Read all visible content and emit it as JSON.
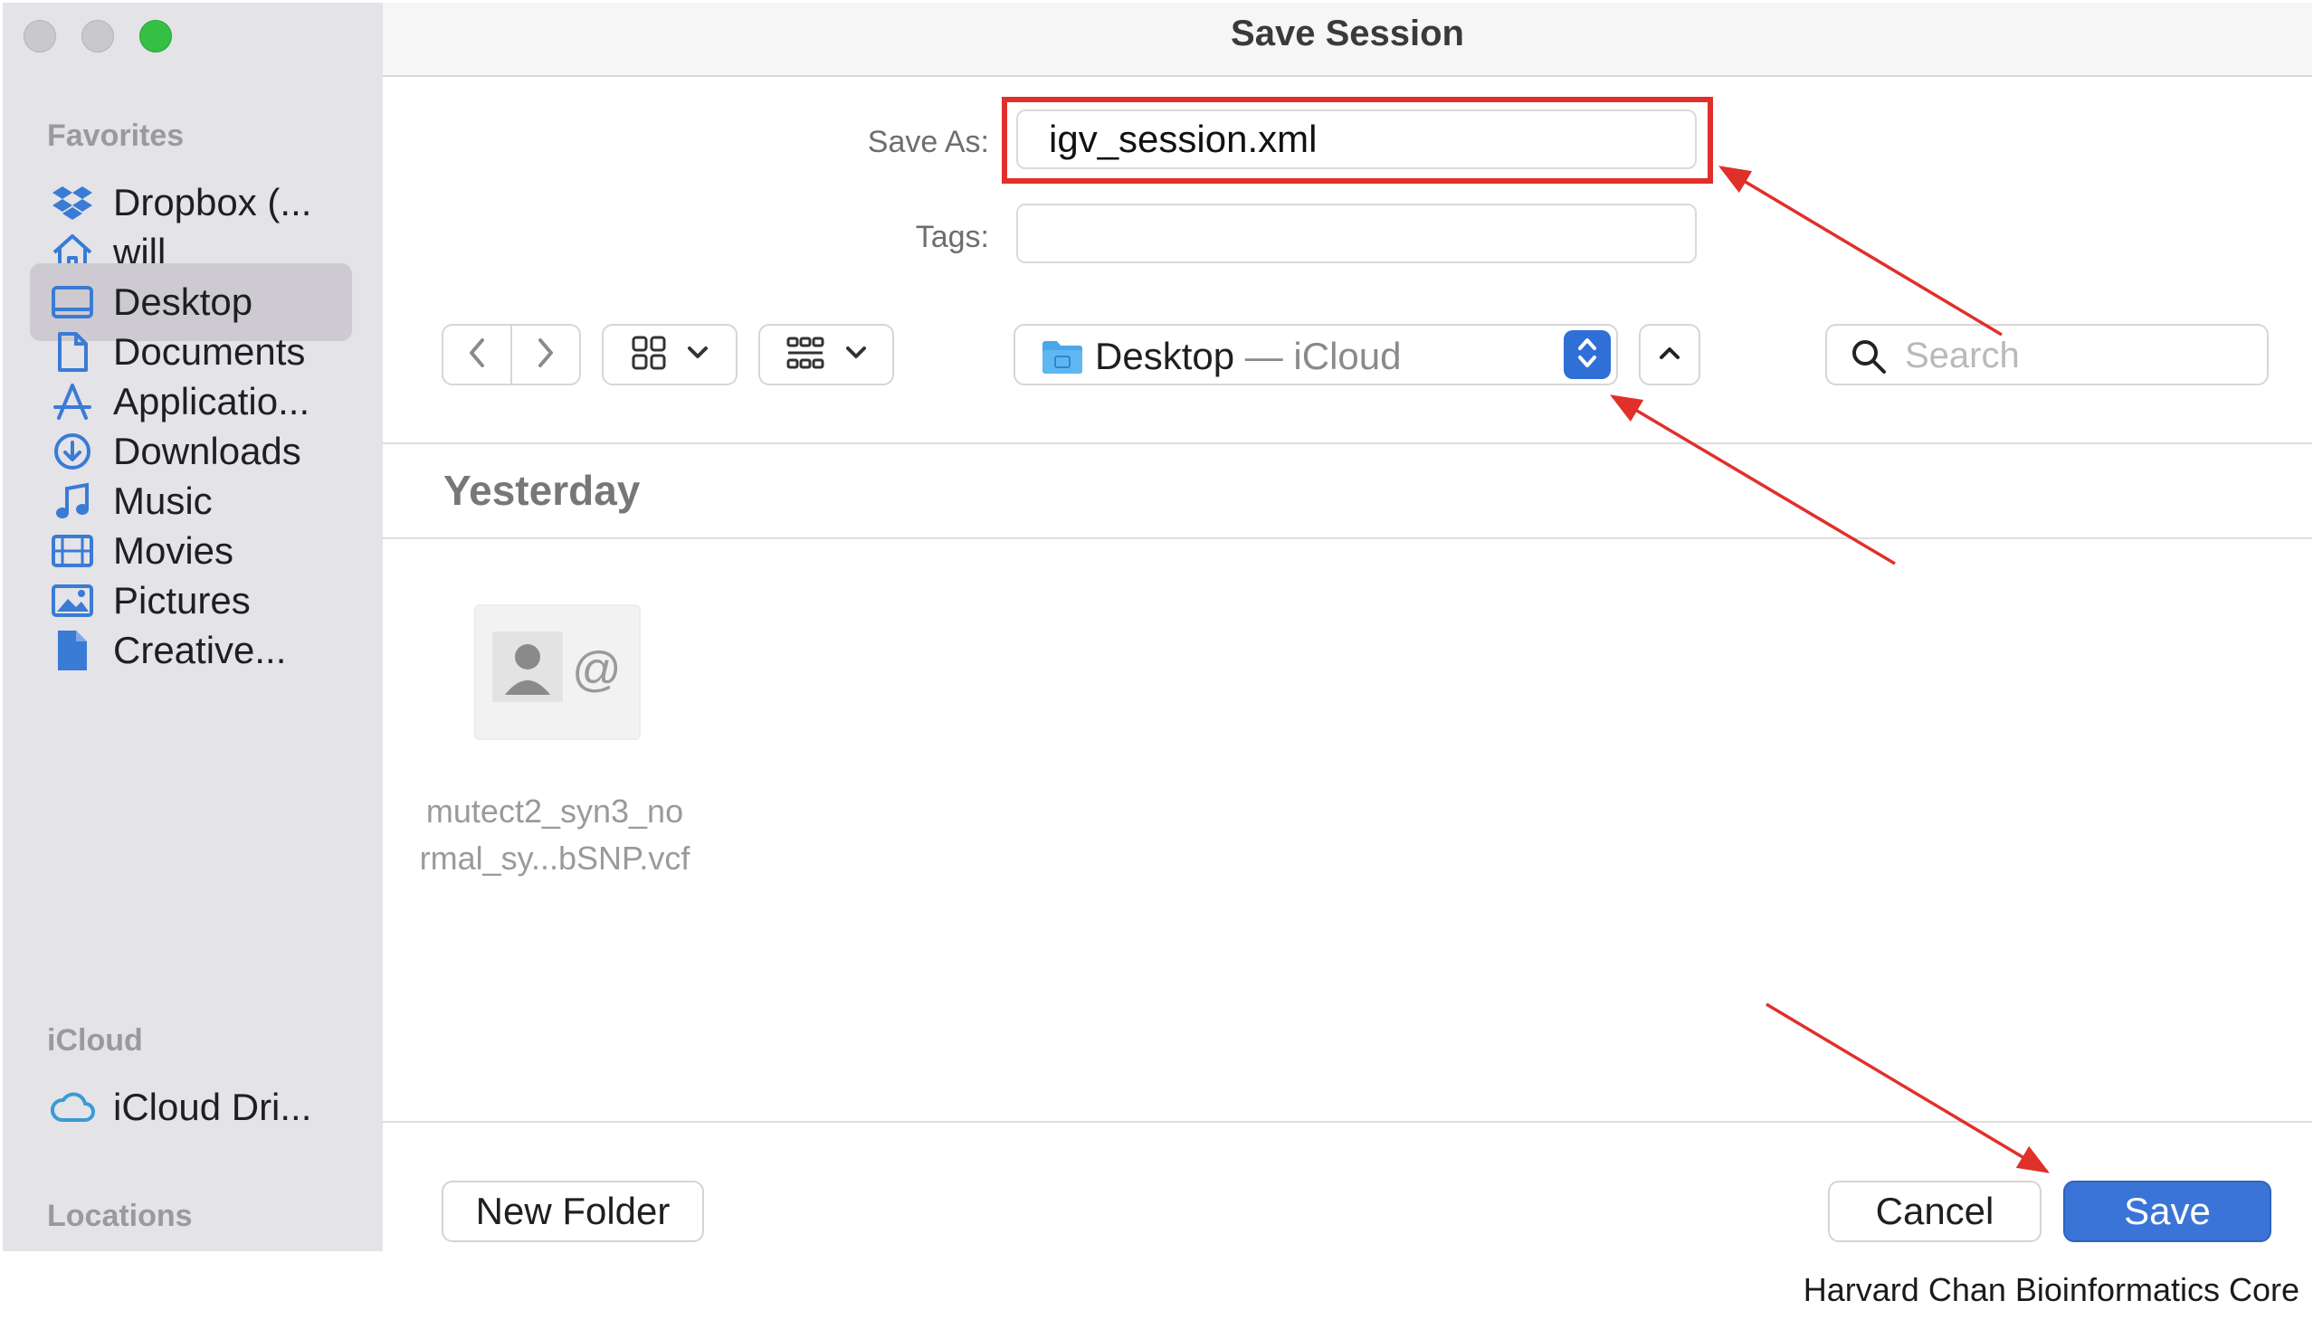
{
  "window": {
    "title": "Save Session"
  },
  "sidebar": {
    "sections": [
      {
        "heading": "Favorites",
        "items": [
          {
            "label": "Dropbox (...",
            "icon": "dropbox-icon",
            "selected": false
          },
          {
            "label": "will",
            "icon": "home-icon",
            "selected": false
          },
          {
            "label": "Desktop",
            "icon": "desktop-icon",
            "selected": true
          },
          {
            "label": "Documents",
            "icon": "document-icon",
            "selected": false
          },
          {
            "label": "Applicatio...",
            "icon": "applications-icon",
            "selected": false
          },
          {
            "label": "Downloads",
            "icon": "downloads-icon",
            "selected": false
          },
          {
            "label": "Music",
            "icon": "music-icon",
            "selected": false
          },
          {
            "label": "Movies",
            "icon": "movies-icon",
            "selected": false
          },
          {
            "label": "Pictures",
            "icon": "pictures-icon",
            "selected": false
          },
          {
            "label": "Creative...",
            "icon": "file-icon",
            "selected": false
          }
        ]
      },
      {
        "heading": "iCloud",
        "items": [
          {
            "label": "iCloud Dri...",
            "icon": "cloud-icon",
            "selected": false
          }
        ]
      },
      {
        "heading": "Locations",
        "items": []
      }
    ]
  },
  "form": {
    "save_as_label": "Save As:",
    "save_as_value": "igv_session.xml",
    "tags_label": "Tags:",
    "tags_value": ""
  },
  "toolbar": {
    "location_name": "Desktop",
    "location_sub": "— iCloud",
    "search_placeholder": "Search"
  },
  "browser": {
    "section_title": "Yesterday",
    "files": [
      {
        "name": "mutect2_syn3_normal_sy...bSNP.vcf",
        "line1": "mutect2_syn3_no",
        "line2": "rmal_sy...bSNP.vcf"
      }
    ]
  },
  "footer": {
    "new_folder_label": "New Folder",
    "cancel_label": "Cancel",
    "save_label": "Save"
  },
  "credit": "Harvard Chan Bioinformatics Core",
  "colors": {
    "accent": "#3a74d6",
    "annotation": "#e0302a",
    "sidebar_bg": "#e4e3e8"
  }
}
